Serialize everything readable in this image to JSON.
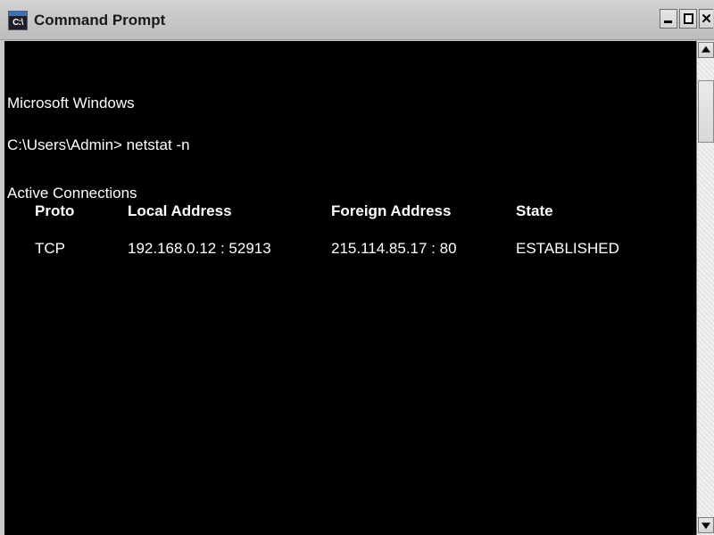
{
  "window": {
    "title": "Command Prompt",
    "icon_name": "command-prompt-icon",
    "icon_text": "C:\\",
    "titlebar_color": "#c8c8c8",
    "controls": {
      "minimize_label": "–",
      "maximize_label": "□",
      "close_label": "✕"
    }
  },
  "console": {
    "background_color": "#000000",
    "text_color": "#ffffff",
    "lines": {
      "banner": "Microsoft Windows",
      "prompt": "C:\\Users\\Admin> netstat -n",
      "section": "Active Connections"
    },
    "table": {
      "headers": {
        "proto": "Proto",
        "local": "Local Address",
        "foreign": "Foreign Address",
        "state": "State"
      },
      "rows": [
        {
          "proto": "TCP",
          "local": "192.168.0.12 : 52913",
          "foreign": "215.114.85.17 : 80",
          "state": "ESTABLISHED"
        }
      ]
    }
  },
  "scrollbar": {
    "up_icon": "scroll-up-arrow",
    "down_icon": "scroll-down-arrow",
    "thumb_name": "scrollbar-thumb"
  }
}
